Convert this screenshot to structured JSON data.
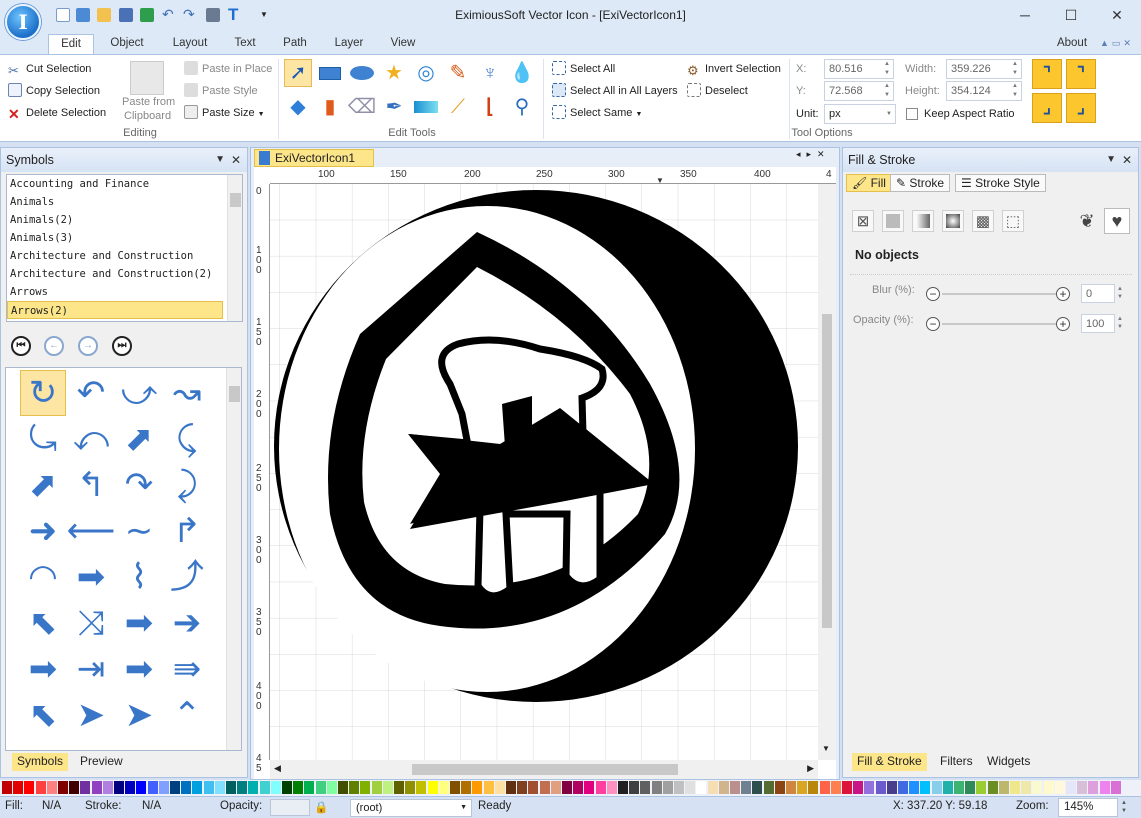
{
  "title": "EximiousSoft Vector Icon - [ExiVectorIcon1]",
  "window_controls": [
    "─",
    "☐",
    "✕"
  ],
  "logo_glyph": "I",
  "menu_tabs": [
    "Edit",
    "Object",
    "Layout",
    "Text",
    "Path",
    "Layer",
    "View"
  ],
  "about": "About",
  "ribbon": {
    "editing": {
      "cut": "Cut Selection",
      "copy": "Copy Selection",
      "delete": "Delete Selection",
      "paste_from_line1": "Paste from",
      "paste_from_line2": "Clipboard",
      "paste_in_place": "Paste in Place",
      "paste_style": "Paste Style",
      "paste_size": "Paste Size",
      "group_label": "Editing"
    },
    "edit_tools_label": "Edit Tools",
    "selection": {
      "select_all": "Select All",
      "select_all_layers": "Select All in All Layers",
      "select_same": "Select Same",
      "invert": "Invert Selection",
      "deselect": "Deselect"
    },
    "tool_options": {
      "x_label": "X:",
      "x_value": "80.516",
      "y_label": "Y:",
      "y_value": "72.568",
      "unit_label": "Unit:",
      "unit_value": "px",
      "width_label": "Width:",
      "width_value": "359.226",
      "height_label": "Height:",
      "height_value": "354.124",
      "keep_aspect": "Keep Aspect Ratio",
      "group_label": "Tool Options"
    }
  },
  "symbols_panel": {
    "title": "Symbols",
    "categories": [
      "Accounting and Finance",
      "Animals",
      "Animals(2)",
      "Animals(3)",
      "Architecture and Construction",
      "Architecture and Construction(2)",
      "Arrows",
      "Arrows(2)"
    ],
    "nav": [
      "⏮",
      "←",
      "→",
      "⏭"
    ],
    "symbols": [
      "↻",
      "↶",
      "⤻",
      "↝",
      "⤿",
      "⤺",
      "⬈",
      "⤹",
      "⬈",
      "↰",
      "↷",
      "⤸",
      "➜",
      "⟵",
      "∼",
      "↱",
      "◠",
      "➡",
      "⌇",
      "⤴",
      "⬉",
      "⤨",
      "➡",
      "➔",
      "➡",
      "⇥",
      "➡",
      "⇛",
      "⬉",
      "➤",
      "➤",
      "⌃"
    ],
    "tabs": [
      "Symbols",
      "Preview"
    ]
  },
  "document_tab": "ExiVectorIcon1",
  "ruler_top": [
    "100",
    "150",
    "200",
    "250",
    "300",
    "350",
    "400",
    "4"
  ],
  "ruler_left": [
    "0",
    "100",
    "150",
    "200",
    "250",
    "300",
    "350",
    "400",
    "45"
  ],
  "fill_stroke_panel": {
    "title": "Fill & Stroke",
    "tabs": [
      "Fill",
      "Stroke",
      "Stroke Style"
    ],
    "no_objects": "No objects",
    "blur_label": "Blur (%):",
    "blur_value": "0",
    "opacity_label": "Opacity (%):",
    "opacity_value": "100",
    "bottom_tabs": [
      "Fill & Stroke",
      "Filters",
      "Widgets"
    ]
  },
  "palette": [
    "#c00000",
    "#e00000",
    "#ff0000",
    "#ff4040",
    "#ff8080",
    "#800000",
    "#400000",
    "#7030a0",
    "#9040c0",
    "#b080e0",
    "#000080",
    "#0000c0",
    "#0000ff",
    "#4060ff",
    "#80a0ff",
    "#004080",
    "#0070c0",
    "#00a0e0",
    "#40c0f0",
    "#80e0ff",
    "#006060",
    "#008080",
    "#00b0b0",
    "#40d0d0",
    "#80ffff",
    "#004000",
    "#008000",
    "#00b050",
    "#40d080",
    "#80ffa0",
    "#405000",
    "#608000",
    "#80b000",
    "#a0d040",
    "#c0f080",
    "#606000",
    "#909000",
    "#c0c000",
    "#ffff00",
    "#ffff80",
    "#805000",
    "#b07000",
    "#ff9900",
    "#ffbf40",
    "#ffe0a0",
    "#603010",
    "#804020",
    "#a05030",
    "#c07050",
    "#e0a080",
    "#800040",
    "#b00060",
    "#e00080",
    "#ff40a0",
    "#ff90c0",
    "#202020",
    "#404040",
    "#606060",
    "#808080",
    "#a0a0a0",
    "#c0c0c0",
    "#e0e0e0",
    "#ffffff",
    "#f5deb3",
    "#d2b48c",
    "#bc8f8f",
    "#708090",
    "#2f4f4f",
    "#556b2f",
    "#8b4513",
    "#cd853f",
    "#daa520",
    "#b8860b",
    "#ff6347",
    "#ff7f50",
    "#dc143c",
    "#c71585",
    "#9370db",
    "#6a5acd",
    "#483d8b",
    "#4169e1",
    "#1e90ff",
    "#00bfff",
    "#87ceeb",
    "#20b2aa",
    "#3cb371",
    "#2e8b57",
    "#9acd32",
    "#6b8e23",
    "#bdb76b",
    "#f0e68c",
    "#eee8aa",
    "#fafad2",
    "#fffacd",
    "#fff8dc",
    "#e6e6fa",
    "#d8bfd8",
    "#dda0dd",
    "#ee82ee",
    "#da70d6"
  ],
  "status": {
    "fill_label": "Fill:",
    "fill_value": "N/A",
    "stroke_label": "Stroke:",
    "stroke_value": "N/A",
    "opacity_label": "Opacity:",
    "layer": "(root)",
    "state": "Ready",
    "coords": "X: 337.20 Y: 59.18",
    "zoom_label": "Zoom:",
    "zoom_value": "145%"
  },
  "colors": {
    "accent": "#2b6cc4",
    "highlight": "#fde58a",
    "symbol_blue": "#3a76c8"
  }
}
